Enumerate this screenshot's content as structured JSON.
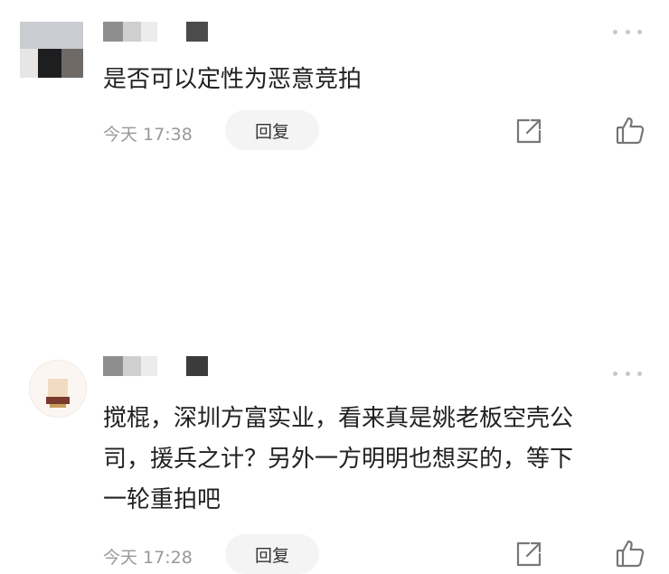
{
  "comments": [
    {
      "text": "是否可以定性为恶意竞拍",
      "time": "今天 17:38",
      "reply_label": "回复"
    },
    {
      "text": "搅棍，深圳方富实业，看来真是姚老板空壳公\n司，援兵之计？另外一方明明也想买的，等下\n一轮重拍吧",
      "time": "今天 17:28",
      "reply_label": "回复"
    }
  ],
  "icons": {
    "more": "more-dots-icon",
    "share": "share-icon",
    "like": "thumbs-up-icon"
  },
  "colors": {
    "text": "#222222",
    "meta": "#999999",
    "reply_bg": "#f4f4f4",
    "icon": "#777777"
  }
}
